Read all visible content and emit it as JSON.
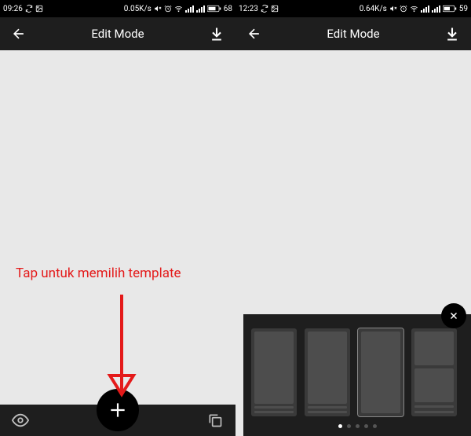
{
  "left": {
    "status": {
      "time": "09:26",
      "speed": "0.05K/s",
      "battery": "68"
    },
    "topbar": {
      "title": "Edit Mode"
    }
  },
  "right": {
    "status": {
      "time": "12:23",
      "speed": "0.64K/s",
      "battery": "59"
    },
    "topbar": {
      "title": "Edit Mode"
    }
  },
  "annotation": {
    "text": "Tap untuk memilih template"
  },
  "panel": {
    "page_count": 5,
    "active_page": 0
  }
}
